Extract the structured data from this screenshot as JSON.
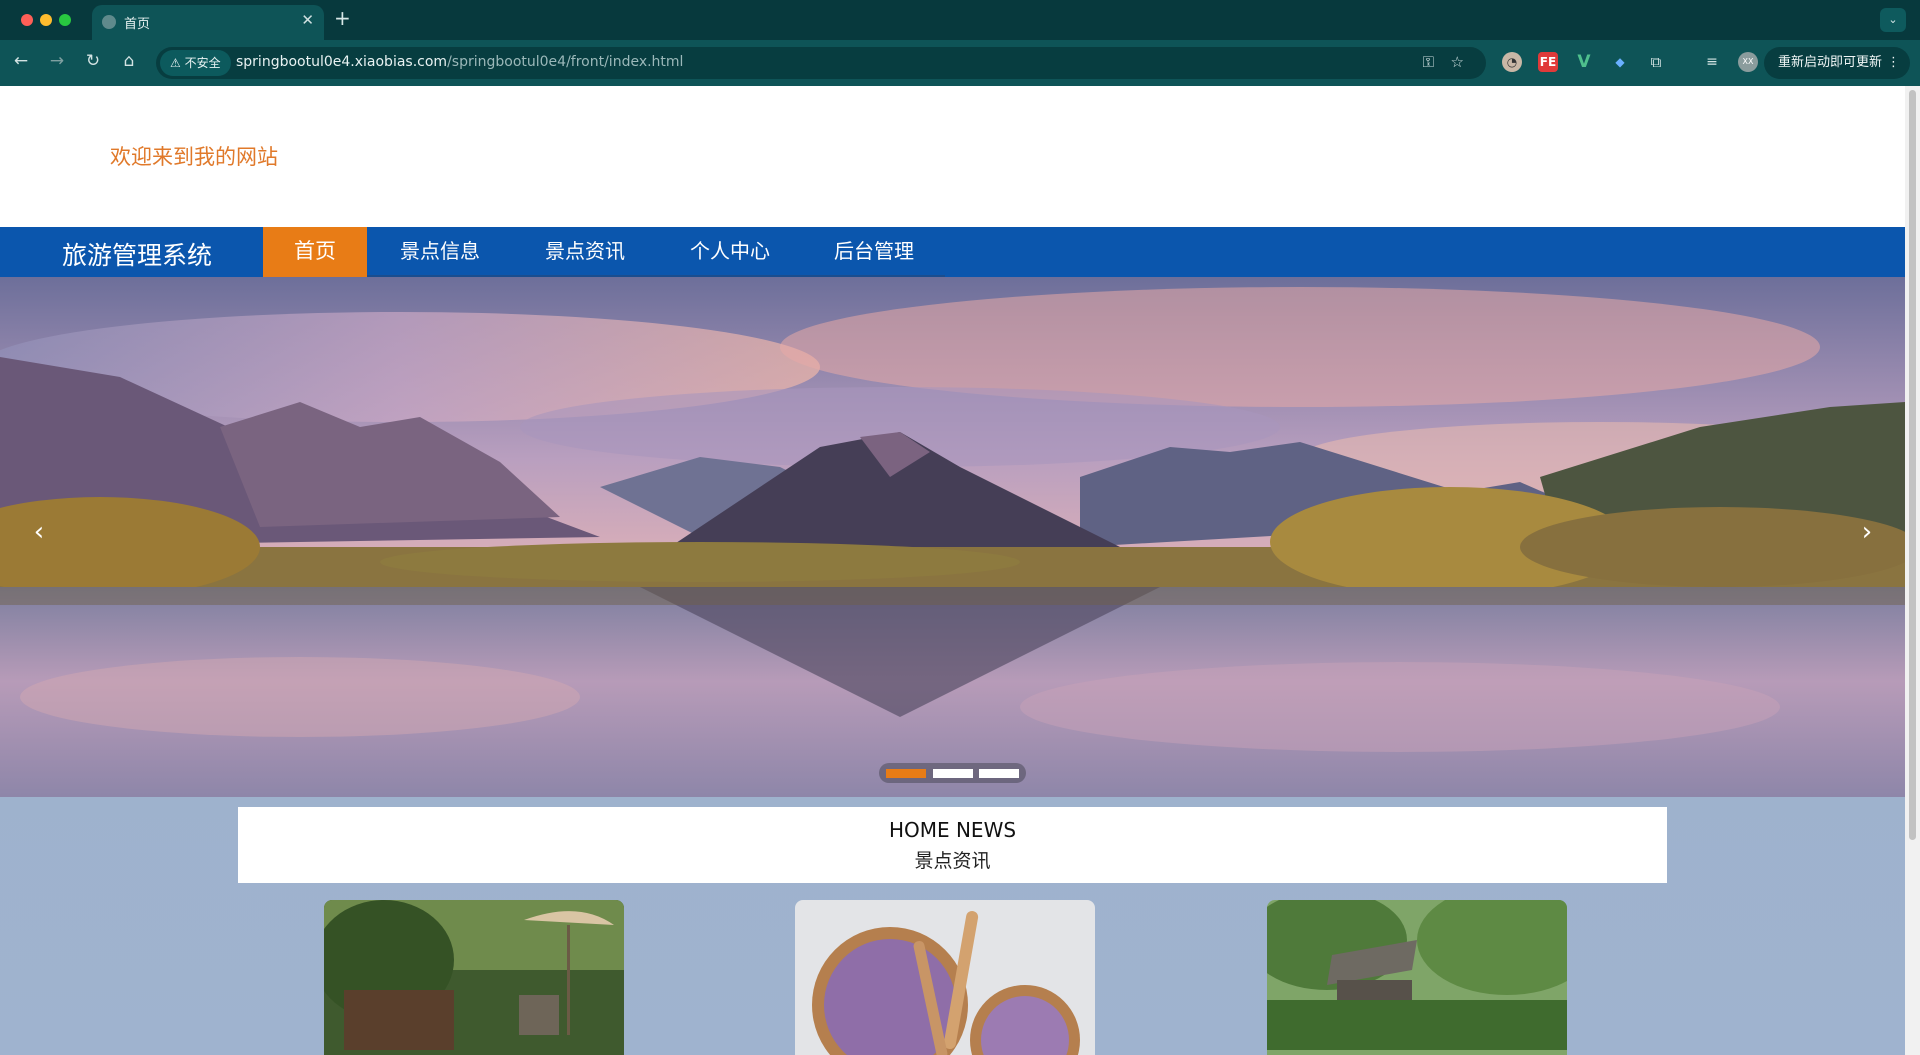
{
  "browser": {
    "tab_title": "首页",
    "new_tab": "+",
    "security_label": "不安全",
    "url_host": "springbootul0e4.xiaobias.com",
    "url_path": "/springbootul0e4/front/index.html",
    "update_label": "重新启动即可更新",
    "ext_fe": "FE",
    "ext_v": "V",
    "ext_avatar": "XX"
  },
  "page": {
    "welcome": "欢迎来到我的网站",
    "brand": "旅游管理系统",
    "nav": [
      {
        "label": "首页",
        "active": true
      },
      {
        "label": "景点信息"
      },
      {
        "label": "景点资讯"
      },
      {
        "label": "个人中心"
      },
      {
        "label": "后台管理"
      }
    ],
    "carousel": {
      "active_index": 0,
      "count": 3
    },
    "news": {
      "title_en": "HOME NEWS",
      "title_cn": "景点资讯"
    }
  },
  "colors": {
    "accent": "#e87c16",
    "nav_bg": "#0b56ad",
    "chrome_bg": "#0e5457"
  }
}
